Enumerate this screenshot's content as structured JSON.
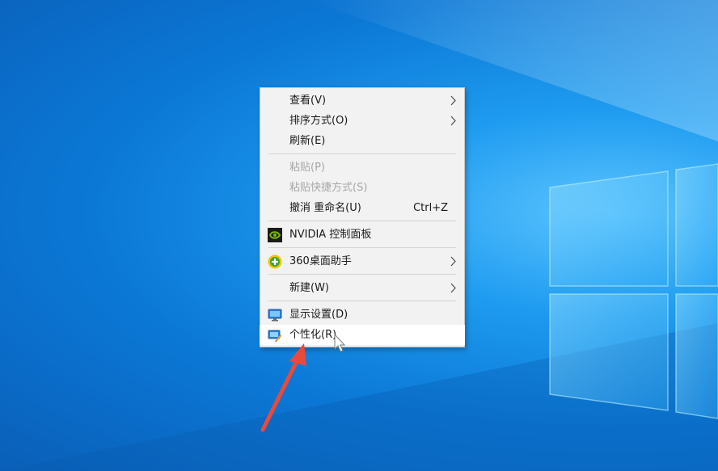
{
  "context_menu": {
    "items": [
      {
        "label": "查看(V)",
        "submenu": true
      },
      {
        "label": "排序方式(O)",
        "submenu": true
      },
      {
        "label": "刷新(E)"
      },
      {
        "label": "粘贴(P)",
        "disabled": true
      },
      {
        "label": "粘贴快捷方式(S)",
        "disabled": true
      },
      {
        "label": "撤消 重命名(U)",
        "shortcut": "Ctrl+Z"
      },
      {
        "label": "NVIDIA 控制面板",
        "icon": "nvidia-icon"
      },
      {
        "label": "360桌面助手",
        "icon": "360-icon",
        "submenu": true
      },
      {
        "label": "新建(W)",
        "submenu": true
      },
      {
        "label": "显示设置(D)",
        "icon": "display-settings-icon"
      },
      {
        "label": "个性化(R)",
        "icon": "personalize-icon",
        "highlighted": true
      }
    ]
  },
  "colors": {
    "menu_background": "#f2f2f2",
    "highlight": "#ffffff",
    "annotation_arrow": "#e84a3c",
    "desktop_blue": "#0b78d6"
  }
}
